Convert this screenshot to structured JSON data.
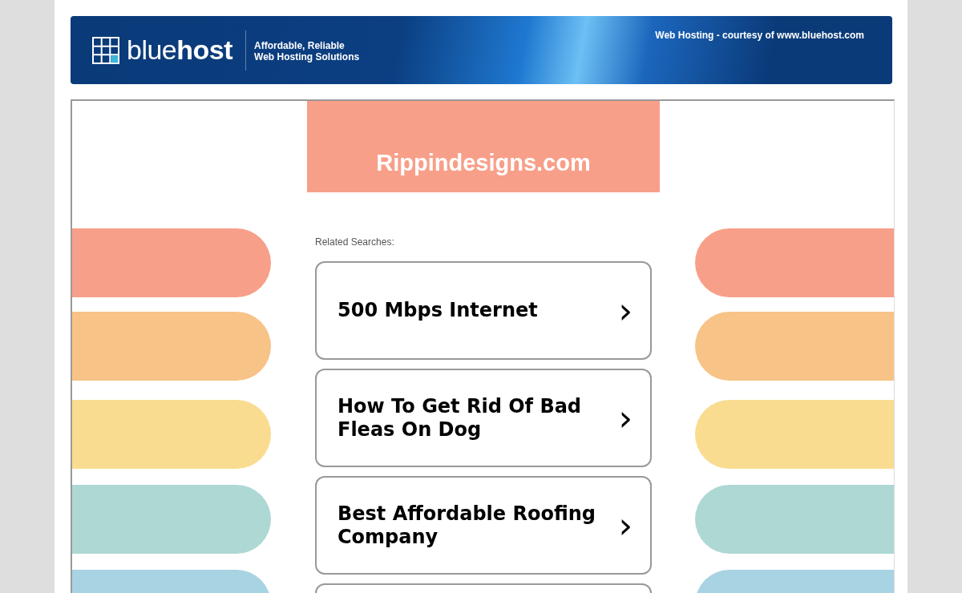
{
  "banner": {
    "logo": "blue**host**",
    "tagline": [
      "Affordable, Reliable",
      "Web Hosting Solutions"
    ],
    "courtesy": "Web Hosting - courtesy of www.bluehost.com"
  },
  "site": {
    "title": "Rippindesigns.com"
  },
  "related": {
    "label": "Related Searches:",
    "items": [
      {
        "text": "500 Mbps Internet",
        "arrow": "›"
      },
      {
        "text": "How To Get Rid Of Bad Fleas On Dog",
        "arrow": "›"
      },
      {
        "text": "Best Affordable Roofing Company",
        "arrow": "›"
      }
    ]
  }
}
